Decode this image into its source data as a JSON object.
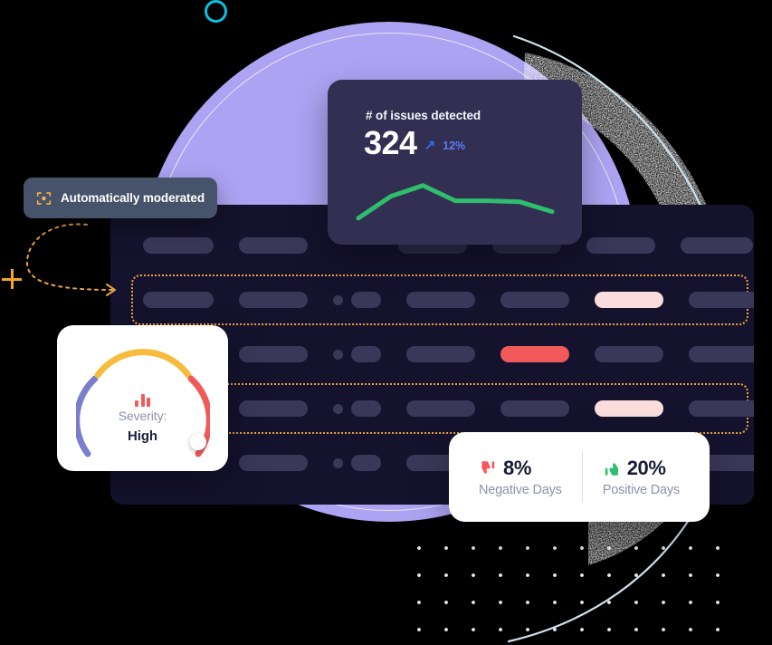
{
  "decor": {
    "cyan_ring": "cyan-ring-outline",
    "plus_mark": "orange-plus-mark",
    "purple_circle_color": "#aea3f3",
    "dot_grid": "white-dot-grid",
    "connector": "orange-dotted-arrow-connector"
  },
  "moderated_badge": {
    "label": "Automatically moderated",
    "icon": "focus-target-icon",
    "icon_color": "#f5b43c",
    "background": "#47536a"
  },
  "issues_card": {
    "title": "# of issues detected",
    "value": "324",
    "trend_arrow": "↗",
    "trend_value": "12%",
    "trend_color": "#5b7df5",
    "background": "#332f52",
    "line_color": "#2fbd6e"
  },
  "chart_data": {
    "type": "line",
    "title": "# of issues detected",
    "xlabel": "",
    "ylabel": "",
    "x": [
      0,
      1,
      2,
      3,
      4,
      5,
      6
    ],
    "series": [
      {
        "name": "issues detected",
        "values": [
          12,
          52,
          72,
          44,
          44,
          42,
          24
        ],
        "color": "#2fbd6e"
      }
    ],
    "ylim": [
      0,
      80
    ],
    "grid": false,
    "legend": "none",
    "annotations": [
      "324",
      "↗ 12%"
    ]
  },
  "severity_card": {
    "icon": "bar-chart-icon",
    "label": "Severity:",
    "value": "High",
    "gauge": {
      "segments": [
        {
          "name": "low",
          "color": "#7b7fcb"
        },
        {
          "name": "medium",
          "color": "#f7bc3e"
        },
        {
          "name": "high",
          "color": "#ef5a5a"
        }
      ],
      "knob": "gauge-knob",
      "needle_position": "high"
    }
  },
  "sentiment_card": {
    "negative": {
      "icon": "thumbs-down-icon",
      "icon_color": "#f2595a",
      "percent": "8%",
      "caption": "Negative Days"
    },
    "positive": {
      "icon": "thumbs-up-icon",
      "icon_color": "#2fbd6e",
      "percent": "20%",
      "caption": "Positive Days"
    }
  },
  "table_panel": {
    "background": "#15122e",
    "flag_border_color": "#e8a33d",
    "rows": [
      {
        "flagged": false,
        "cells": [
          {
            "kind": "pill",
            "size": "w-wide",
            "tone": "normal"
          },
          {
            "kind": "pill",
            "size": "w-med",
            "tone": "normal"
          },
          {
            "kind": "gap"
          },
          {
            "kind": "pill",
            "size": "w-med",
            "tone": "faint"
          },
          {
            "kind": "pill",
            "size": "w-med",
            "tone": "faint"
          },
          {
            "kind": "pill",
            "size": "w-med",
            "tone": "normal"
          },
          {
            "kind": "pill",
            "size": "w-lg",
            "tone": "normal"
          }
        ]
      },
      {
        "flagged": true,
        "cells": [
          {
            "kind": "pill",
            "size": "w-wide",
            "tone": "normal"
          },
          {
            "kind": "pill",
            "size": "w-med",
            "tone": "normal"
          },
          {
            "kind": "dotpill"
          },
          {
            "kind": "pill",
            "size": "w-med",
            "tone": "normal"
          },
          {
            "kind": "pill",
            "size": "w-med",
            "tone": "normal"
          },
          {
            "kind": "pill",
            "size": "w-med",
            "tone": "highlight-light"
          },
          {
            "kind": "pill",
            "size": "w-lg",
            "tone": "normal"
          }
        ]
      },
      {
        "flagged": false,
        "cells": [
          {
            "kind": "pill",
            "size": "w-wide",
            "tone": "normal"
          },
          {
            "kind": "pill",
            "size": "w-med",
            "tone": "normal"
          },
          {
            "kind": "dotpill"
          },
          {
            "kind": "pill",
            "size": "w-med",
            "tone": "normal"
          },
          {
            "kind": "pill",
            "size": "w-med",
            "tone": "highlight-red"
          },
          {
            "kind": "pill",
            "size": "w-med",
            "tone": "normal"
          },
          {
            "kind": "pill",
            "size": "w-lg",
            "tone": "normal"
          }
        ]
      },
      {
        "flagged": true,
        "cells": [
          {
            "kind": "pill",
            "size": "w-wide",
            "tone": "normal"
          },
          {
            "kind": "pill",
            "size": "w-med",
            "tone": "normal"
          },
          {
            "kind": "dotpill"
          },
          {
            "kind": "pill",
            "size": "w-med",
            "tone": "normal"
          },
          {
            "kind": "pill",
            "size": "w-med",
            "tone": "normal"
          },
          {
            "kind": "pill",
            "size": "w-med",
            "tone": "highlight-light"
          },
          {
            "kind": "pill",
            "size": "w-lg",
            "tone": "normal"
          }
        ]
      },
      {
        "flagged": false,
        "cells": [
          {
            "kind": "pill",
            "size": "w-wide",
            "tone": "normal"
          },
          {
            "kind": "pill",
            "size": "w-med",
            "tone": "normal"
          },
          {
            "kind": "dotpill"
          },
          {
            "kind": "pill",
            "size": "w-med",
            "tone": "normal"
          },
          {
            "kind": "pill",
            "size": "w-med",
            "tone": "normal"
          },
          {
            "kind": "pill",
            "size": "w-med",
            "tone": "normal"
          },
          {
            "kind": "pill",
            "size": "w-lg",
            "tone": "normal"
          }
        ]
      }
    ]
  }
}
